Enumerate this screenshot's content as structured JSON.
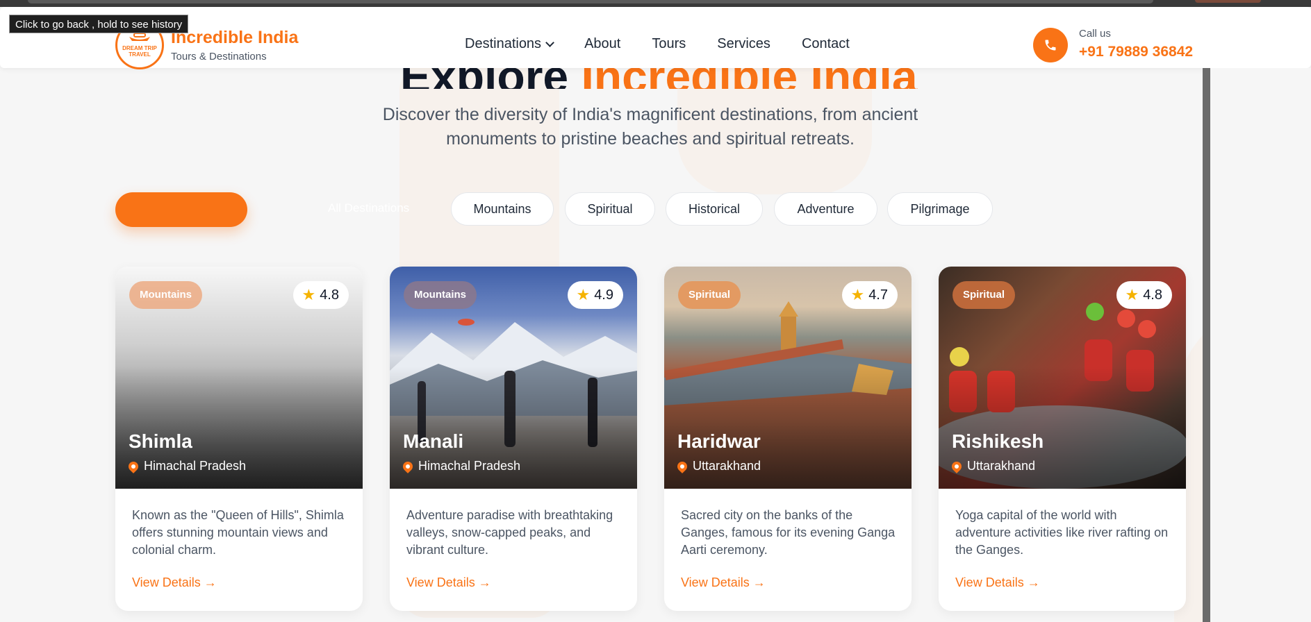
{
  "tooltip": "Click to go back , hold to see history",
  "brand": {
    "logo_text": "DREAM TRIP TRAVEL",
    "title": "Incredible India",
    "subtitle": "Tours & Destinations"
  },
  "nav": [
    "Destinations",
    "About",
    "Tours",
    "Services",
    "Contact"
  ],
  "contact": {
    "label": "Call us",
    "phone": "+91 79889 36842"
  },
  "hero": {
    "title_part1": "Explore",
    "title_part2": "Incredible India",
    "subtitle": "Discover the diversity of India's magnificent destinations, from ancient monuments to pristine beaches and spiritual retreats."
  },
  "filters": {
    "active": "All Destinations",
    "items": [
      "Mountains",
      "Spiritual",
      "Historical",
      "Adventure",
      "Pilgrimage"
    ]
  },
  "cards": [
    {
      "category": "Mountains",
      "rating": "4.8",
      "name": "Shimla",
      "location": "Himachal Pradesh",
      "description": "Known as the \"Queen of Hills\", Shimla offers stunning mountain views and colonial charm.",
      "link": "View Details →"
    },
    {
      "category": "Mountains",
      "rating": "4.9",
      "name": "Manali",
      "location": "Himachal Pradesh",
      "description": "Adventure paradise with breathtaking valleys, snow-capped peaks, and vibrant culture.",
      "link": "View Details →"
    },
    {
      "category": "Spiritual",
      "rating": "4.7",
      "name": "Haridwar",
      "location": "Uttarakhand",
      "description": "Sacred city on the banks of the Ganges, famous for its evening Ganga Aarti ceremony.",
      "link": "View Details →"
    },
    {
      "category": "Spiritual",
      "rating": "4.8",
      "name": "Rishikesh",
      "location": "Uttarakhand",
      "description": "Yoga capital of the world with adventure activities like river rafting on the Ganges.",
      "link": "View Details →"
    }
  ],
  "icons": {
    "phone": "phone-icon",
    "star": "star-icon",
    "location": "map-pin-icon",
    "dropdown": "chevron-down-icon"
  },
  "colors": {
    "accent": "#f97316",
    "text": "#1f2937",
    "muted": "#4b5563"
  }
}
